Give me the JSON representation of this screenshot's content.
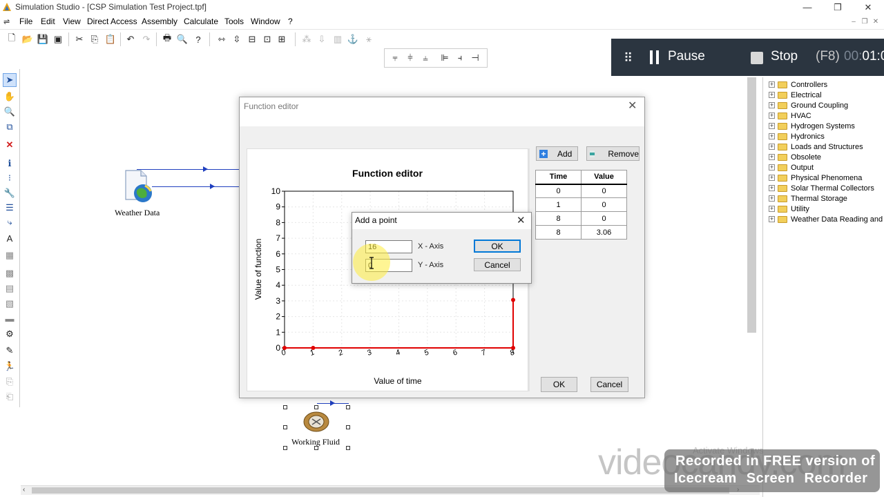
{
  "window": {
    "title": "Simulation Studio - [CSP Simulation Test Project.tpf]",
    "minimize": "—",
    "restore": "❐",
    "close": "✕"
  },
  "menubar": {
    "items": [
      "File",
      "Edit",
      "View",
      "Direct Access",
      "Assembly",
      "Calculate",
      "Tools",
      "Window",
      "?"
    ]
  },
  "recorder": {
    "pause_label": "Pause",
    "stop_label": "Stop",
    "stop_shortcut": "(F8)",
    "timer_dim": "00:",
    "timer": "01:0"
  },
  "canvas": {
    "components": [
      {
        "label": "Weather Data",
        "icon": "weather-data-icon"
      },
      {
        "label": "Working Fluid",
        "icon": "working-fluid-icon"
      }
    ]
  },
  "tree": {
    "items": [
      "Controllers",
      "Electrical",
      "Ground Coupling",
      "HVAC",
      "Hydrogen Systems",
      "Hydronics",
      "Loads and Structures",
      "Obsolete",
      "Output",
      "Physical Phenomena",
      "Solar Thermal Collectors",
      "Thermal Storage",
      "Utility",
      "Weather Data Reading and F"
    ]
  },
  "function_editor": {
    "title": "Function editor",
    "add_label": "Add",
    "remove_label": "Remove",
    "ok_label": "OK",
    "cancel_label": "Cancel",
    "table": {
      "headers": [
        "Time",
        "Value"
      ],
      "rows": [
        [
          "0",
          "0"
        ],
        [
          "1",
          "0"
        ],
        [
          "8",
          "0"
        ],
        [
          "8",
          "3.06"
        ]
      ]
    }
  },
  "chart_data": {
    "type": "line",
    "title": "Function editor",
    "xlabel": "Value of time",
    "ylabel": "Value of function",
    "x": [
      0,
      1,
      8,
      8
    ],
    "series": [
      {
        "values": [
          0,
          0,
          0,
          3.06
        ],
        "color": "#e00000"
      }
    ],
    "xlim": [
      0,
      8
    ],
    "ylim": [
      0,
      10
    ],
    "xticks": [
      "0",
      "1",
      "2",
      "3",
      "4",
      "5",
      "6",
      "7",
      "8"
    ],
    "yticks": [
      "0",
      "1",
      "2",
      "3",
      "4",
      "5",
      "6",
      "7",
      "8",
      "9",
      "10"
    ],
    "grid": true
  },
  "add_point": {
    "title": "Add a point",
    "x_value": "16",
    "y_value": "0",
    "x_label": "X - Axis",
    "y_label": "Y - Axis",
    "ok_label": "OK",
    "cancel_label": "Cancel"
  },
  "watermarks": {
    "brand": "videocandy.com",
    "line1": "Recorded in FREE version of",
    "line2": "Icecream Screen Recorder",
    "activate": "Activate Windows"
  }
}
